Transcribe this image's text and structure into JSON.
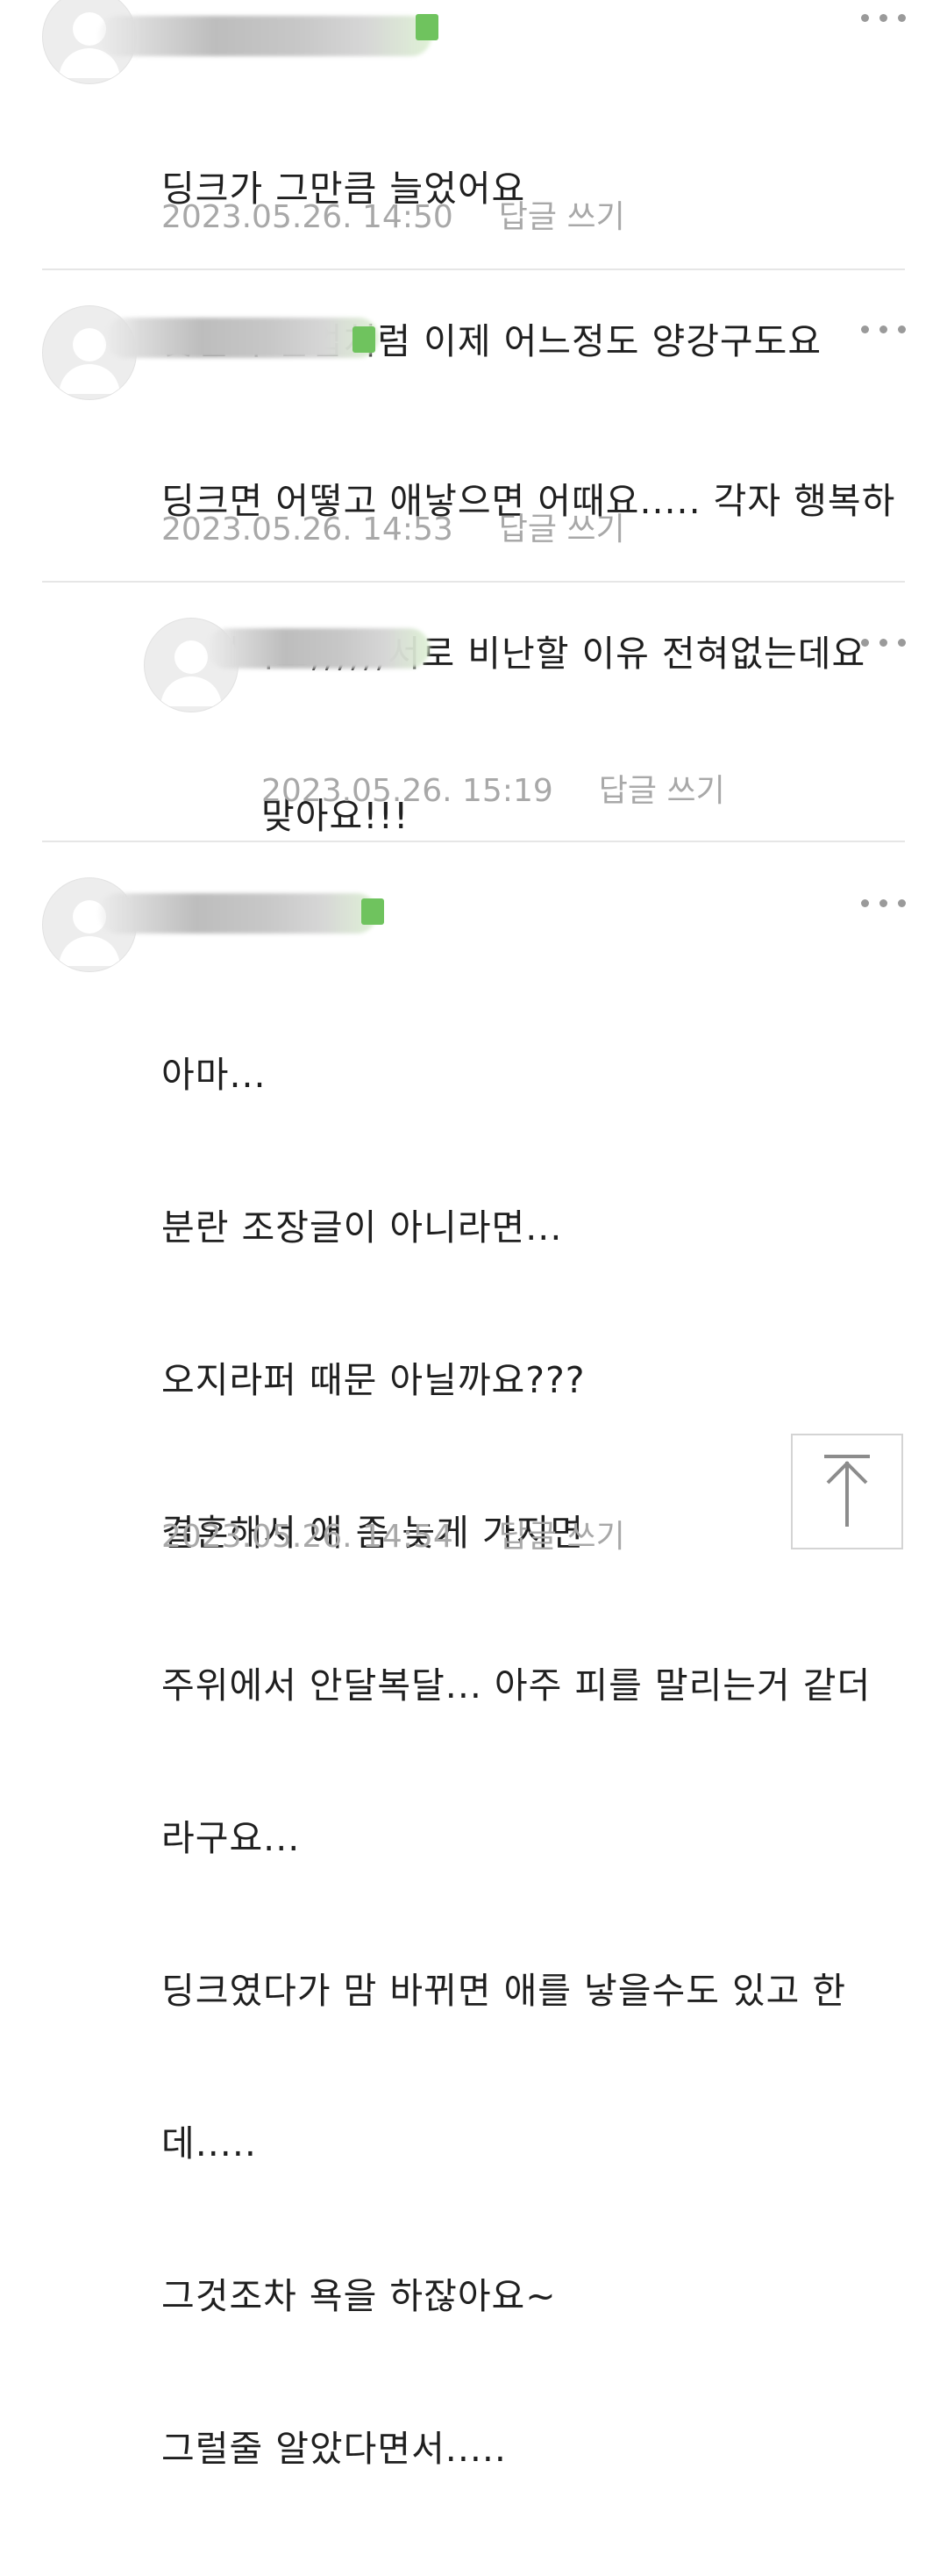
{
  "comments": [
    {
      "lines": [
        "딩크가 그만큼 늘었어요",
        "맞벌이 전업처럼 이제 어느정도 양강구도요"
      ],
      "date": "2023.05.26. 14:50",
      "reply_label": "답글 쓰기"
    },
    {
      "lines": [
        "딩크면 어떻고 애낳으면 어때요..... 각자 행복하",
        "면 된거죠;;;;;;서로 비난할 이유 전혀없는데요"
      ],
      "date": "2023.05.26. 14:53",
      "reply_label": "답글 쓰기"
    },
    {
      "lines": [
        "맞아요!!!"
      ],
      "date": "2023.05.26. 15:19",
      "reply_label": "답글 쓰기"
    },
    {
      "lines": [
        "아마...",
        "분란 조장글이 아니라면...",
        "오지라퍼 때문 아닐까요???",
        "결혼해서 애 좀 늦게 가지면",
        "주위에서 안달복달... 아주 피를 말리는거 같더",
        "라구요...",
        "딩크였다가 맘 바뀌면 애를 낳을수도 있고 한",
        "데.....",
        "그것조차 욕을 하잖아요~",
        "그럴줄 알았다면서....."
      ],
      "date": "2023.05.26. 14:54",
      "reply_label": "답글 쓰기"
    }
  ],
  "icons": {
    "avatar": "default-user-avatar-icon",
    "more": "more-dots-icon",
    "scroll_top": "arrow-up-to-top-icon",
    "badge": "green-member-badge-icon"
  },
  "colors": {
    "text": "#1f1f1f",
    "meta": "#a8a8a8",
    "divider": "#e6e6e6",
    "badge": "#6fc35e"
  }
}
